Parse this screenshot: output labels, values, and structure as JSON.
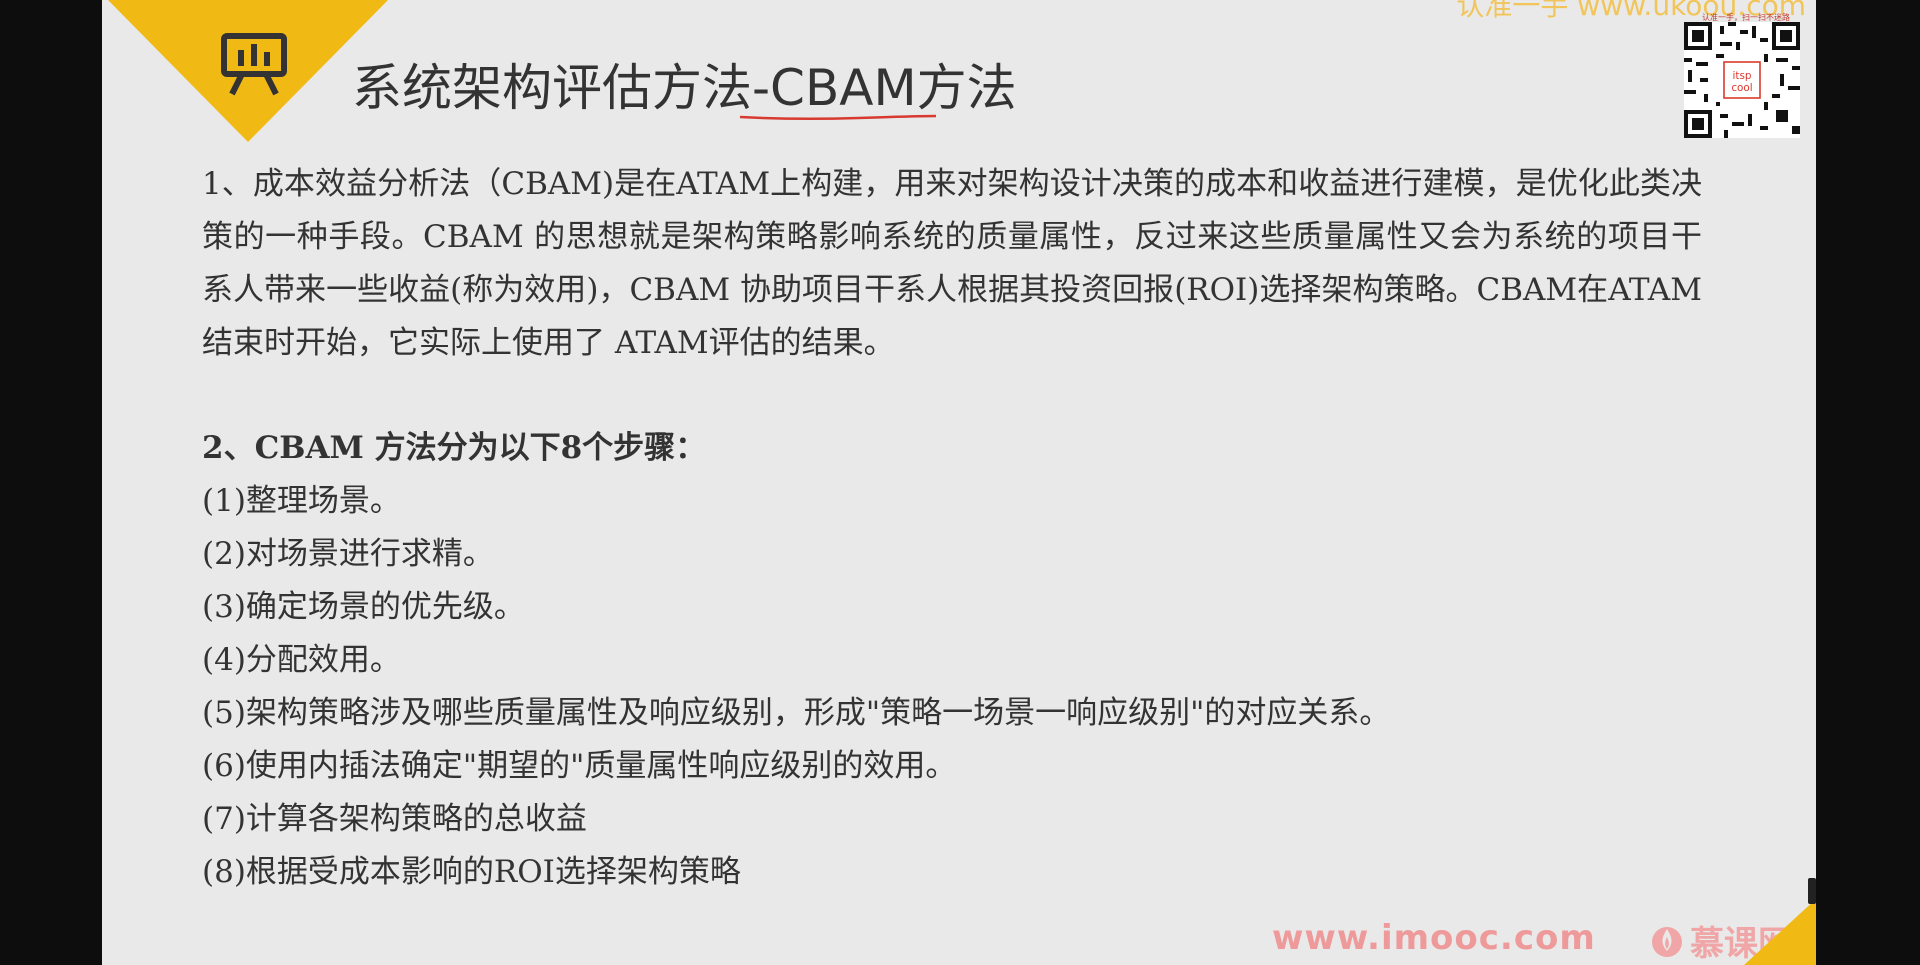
{
  "slide": {
    "title": "系统架构评估方法-CBAM方法",
    "icon": "presentation-board-icon",
    "accent_color": "#f1b913",
    "underline_color": "#d83a2f",
    "watermark_top": "认准一手 www.ukoou.com",
    "qr_caption": "认准一手，扫一扫不迷路",
    "qr_center_text": "itspcool",
    "intro": "1、成本效益分析法（CBAM)是在ATAM上构建，用来对架构设计决策的成本和收益进行建模，是优化此类决策的一种手段。CBAM 的思想就是架构策略影响系统的质量属性，反过来这些质量属性又会为系统的项目干系人带来一些收益(称为效用)，CBAM 协助项目干系人根据其投资回报(ROI)选择架构策略。CBAM在ATAM结束时开始，它实际上使用了 ATAM评估的结果。",
    "steps_heading": "2、CBAM 方法分为以下8个步骤：",
    "steps": [
      "(1)整理场景。",
      "(2)对场景进行求精。",
      "(3)确定场景的优先级。",
      "(4)分配效用。",
      "(5)架构策略涉及哪些质量属性及响应级别，形成\"策略一场景一响应级别\"的对应关系。",
      "(6)使用内插法确定\"期望的\"质量属性响应级别的效用。",
      "(7)计算各架构策略的总收益",
      "(8)根据受成本影响的ROI选择架构策略"
    ],
    "footer_url": "www.imooc.com",
    "brand_name": "慕课网",
    "brand_icon": "flame-logo-icon"
  }
}
